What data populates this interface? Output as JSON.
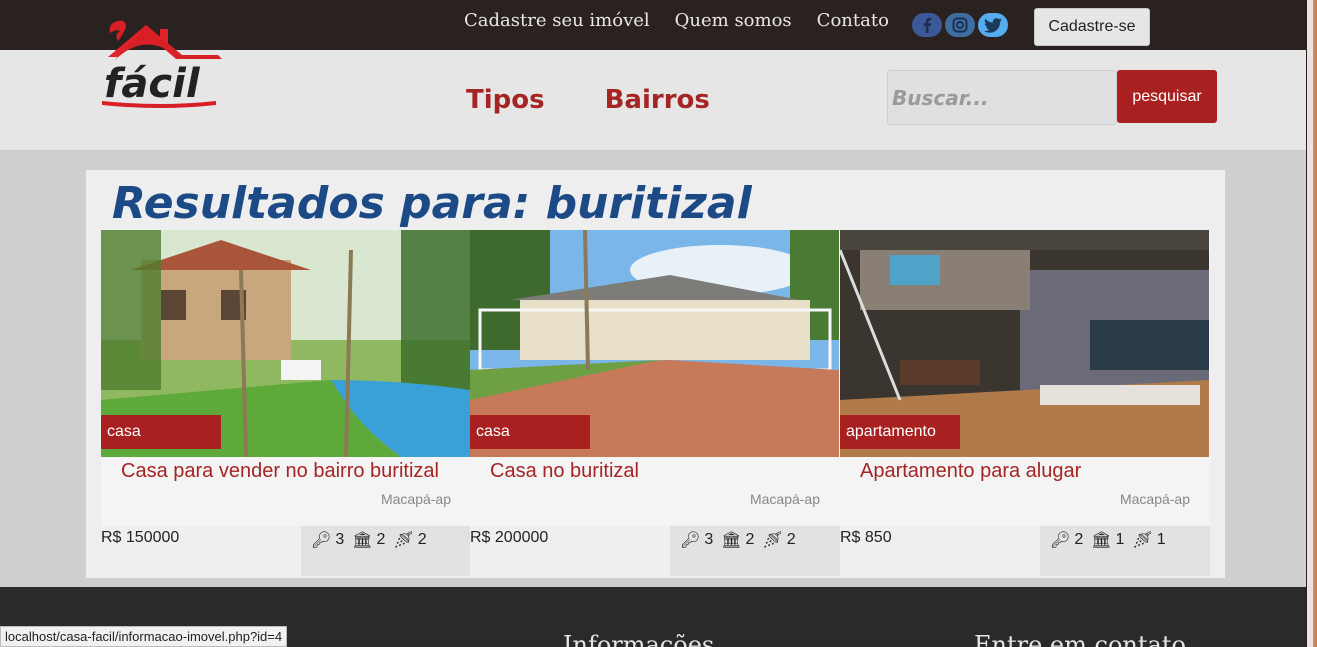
{
  "topbar": {
    "links": [
      "Cadastre seu imóvel",
      "Quem somos",
      "Contato"
    ],
    "social": [
      "facebook-icon",
      "instagram-icon",
      "twitter-icon"
    ],
    "signup_label": "Cadastre-se"
  },
  "navbar": {
    "logo_text": "fácil",
    "links": [
      "Tipos",
      "Bairros"
    ],
    "search_placeholder": "Buscar...",
    "search_button": "pesquisar"
  },
  "results": {
    "heading": "Resultados para: buritizal",
    "cards": [
      {
        "type": "casa",
        "title": "Casa para vender no bairro buritizal",
        "city": "Macapá-ap",
        "price": "R$ 150000",
        "keys": "3",
        "banks": "2",
        "baths": "2"
      },
      {
        "type": "casa",
        "title": "Casa no buritizal",
        "city": "Macapá-ap",
        "price": "R$ 200000",
        "keys": "3",
        "banks": "2",
        "baths": "2"
      },
      {
        "type": "apartamento",
        "title": "Apartamento para alugar",
        "city": "Macapá-ap",
        "price": "R$ 850",
        "keys": "2",
        "banks": "1",
        "baths": "1"
      }
    ]
  },
  "footer": {
    "col1_heading": "Informações",
    "col2_heading": "Entre em contato"
  },
  "status_url": "localhost/casa-facil/informacao-imovel.php?id=4",
  "colors": {
    "brand_red": "#a8201f",
    "heading_blue": "#1c4a86",
    "topbar": "#2a2220"
  }
}
